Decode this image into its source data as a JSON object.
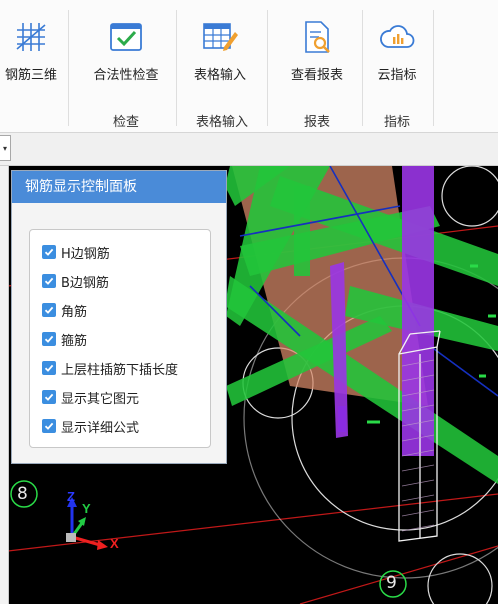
{
  "ribbon": {
    "buttons": [
      {
        "label": "钢筋三维",
        "icon": "rebar-3d-icon"
      },
      {
        "label": "合法性检查",
        "icon": "validity-check-icon"
      },
      {
        "label": "表格输入",
        "icon": "table-input-icon"
      },
      {
        "label": "查看报表",
        "icon": "view-report-icon"
      },
      {
        "label": "云指标",
        "icon": "cloud-index-icon"
      }
    ],
    "groups": [
      {
        "label": "检查"
      },
      {
        "label": "表格输入"
      },
      {
        "label": "报表"
      },
      {
        "label": "指标"
      }
    ]
  },
  "toolbar": {
    "dropdown_arrow": "▾"
  },
  "panel": {
    "title": "钢筋显示控制面板",
    "options": [
      {
        "label": "H边钢筋",
        "checked": true
      },
      {
        "label": "B边钢筋",
        "checked": true
      },
      {
        "label": "角筋",
        "checked": true
      },
      {
        "label": "箍筋",
        "checked": true
      },
      {
        "label": "上层柱插筋下插长度",
        "checked": true
      },
      {
        "label": "显示其它图元",
        "checked": true
      },
      {
        "label": "显示详细公式",
        "checked": true
      }
    ]
  },
  "viewport": {
    "axis_markers": [
      "8",
      "9"
    ],
    "axes": {
      "x": "X",
      "y": "Y",
      "z": "Z"
    }
  },
  "colors": {
    "accent": "#4a8bd8",
    "checkbox": "#3b8ee0",
    "beam_green": "#22c53a",
    "column_purple": "#9a35e6",
    "viewport_bg": "#000000"
  }
}
